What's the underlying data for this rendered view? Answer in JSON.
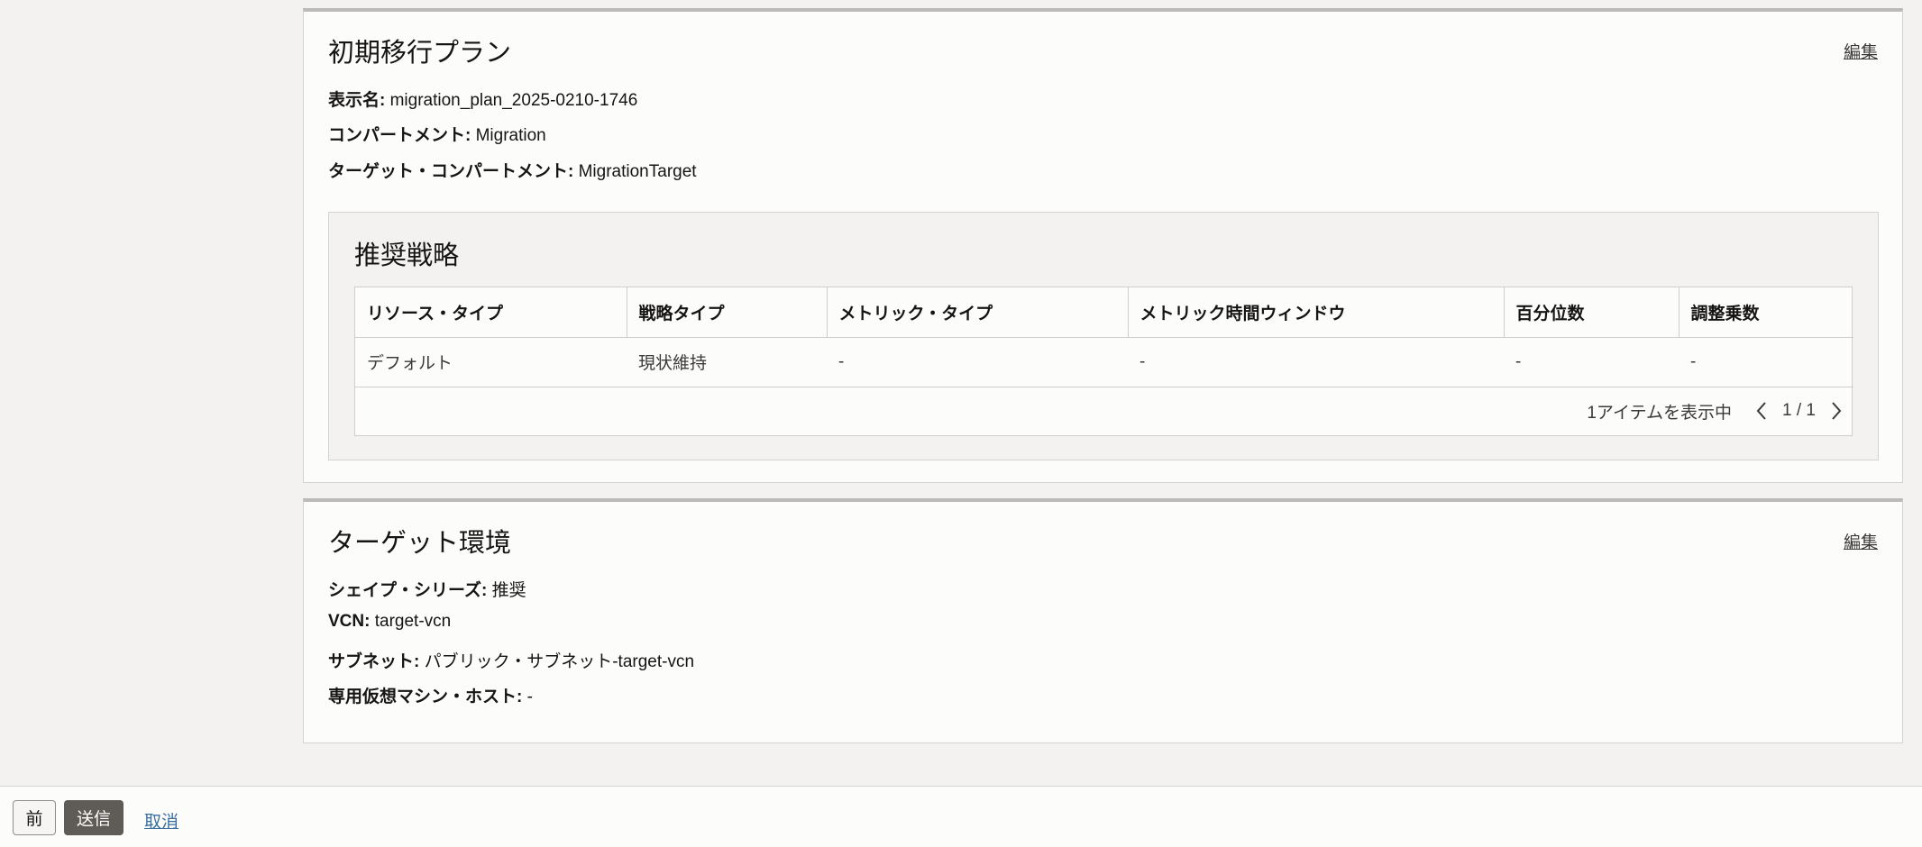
{
  "initial_plan": {
    "title": "初期移行プラン",
    "edit_label": "編集",
    "display_name_label": "表示名:",
    "display_name_value": "migration_plan_2025-0210-1746",
    "compartment_label": "コンパートメント:",
    "compartment_value": "Migration",
    "target_compartment_label": "ターゲット・コンパートメント:",
    "target_compartment_value": "MigrationTarget",
    "strategy": {
      "title": "推奨戦略",
      "columns": [
        "リソース・タイプ",
        "戦略タイプ",
        "メトリック・タイプ",
        "メトリック時間ウィンドウ",
        "百分位数",
        "調整乗数"
      ],
      "rows": [
        [
          "デフォルト",
          "現状維持",
          "-",
          "-",
          "-",
          "-"
        ]
      ],
      "footer_text": "1アイテムを表示中",
      "page_indicator": "1 / 1"
    }
  },
  "target_env": {
    "title": "ターゲット環境",
    "edit_label": "編集",
    "shape_series_label": "シェイプ・シリーズ:",
    "shape_series_value": "推奨",
    "vcn_label": "VCN:",
    "vcn_value": "target-vcn",
    "subnet_label": "サブネット:",
    "subnet_value": "パブリック・サブネット-target-vcn",
    "dedicated_host_label": "専用仮想マシン・ホスト:",
    "dedicated_host_value": "-"
  },
  "footer": {
    "prev_label": "前",
    "submit_label": "送信",
    "cancel_label": "取消"
  },
  "colors": {
    "page_background": "#f3f2f1",
    "card_background": "#fcfcfb",
    "primary_button": "#5f5b56",
    "link": "#3a6f9e"
  }
}
